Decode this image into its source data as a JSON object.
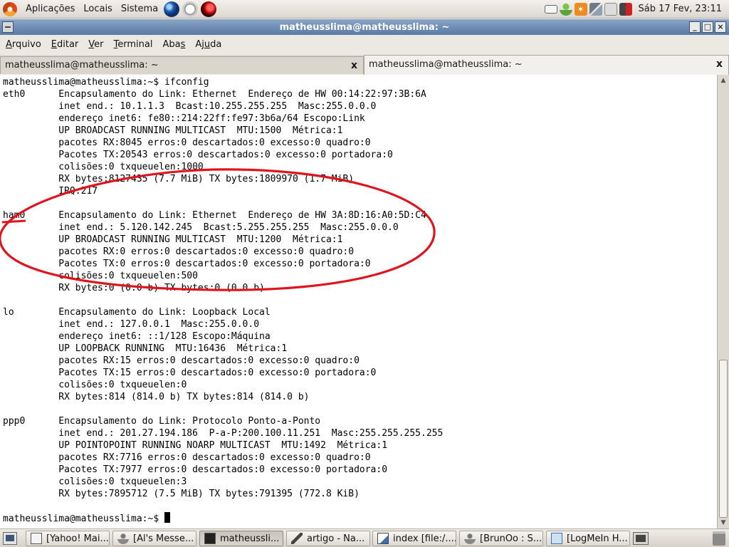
{
  "top_panel": {
    "menus": [
      "Aplicações",
      "Locais",
      "Sistema"
    ],
    "launchers": [
      "globe-icon",
      "clock-icon",
      "bug-icon"
    ],
    "tray_icons": [
      "mail-icon",
      "user-icon",
      "update-icon",
      "network-icon",
      "volume-icon",
      "quit-icon"
    ],
    "clock": "Sáb 17 Fev, 23:11"
  },
  "window": {
    "title": "matheusslima@matheusslima: ~",
    "menu": [
      {
        "pre": "",
        "key": "A",
        "post": "rquivo"
      },
      {
        "pre": "",
        "key": "E",
        "post": "ditar"
      },
      {
        "pre": "",
        "key": "V",
        "post": "er"
      },
      {
        "pre": "",
        "key": "T",
        "post": "erminal"
      },
      {
        "pre": "Aba",
        "key": "s",
        "post": ""
      },
      {
        "pre": "Aj",
        "key": "u",
        "post": "da"
      }
    ],
    "tabs": [
      {
        "label": "matheusslima@matheusslima: ~",
        "close": "x"
      },
      {
        "label": "matheusslima@matheusslima: ~",
        "close": "x"
      }
    ]
  },
  "terminal": {
    "lines": [
      "matheusslima@matheusslima:~$ ifconfig",
      "eth0      Encapsulamento do Link: Ethernet  Endereço de HW 00:14:22:97:3B:6A",
      "          inet end.: 10.1.1.3  Bcast:10.255.255.255  Masc:255.0.0.0",
      "          endereço inet6: fe80::214:22ff:fe97:3b6a/64 Escopo:Link",
      "          UP BROADCAST RUNNING MULTICAST  MTU:1500  Métrica:1",
      "          pacotes RX:8045 erros:0 descartados:0 excesso:0 quadro:0",
      "          Pacotes TX:20543 erros:0 descartados:0 excesso:0 portadora:0",
      "          colisões:0 txqueuelen:1000",
      "          RX bytes:8127435 (7.7 MiB) TX bytes:1809970 (1.7 MiB)",
      "          IRQ:217",
      "",
      "ham0      Encapsulamento do Link: Ethernet  Endereço de HW 3A:8D:16:A0:5D:C4",
      "          inet end.: 5.120.142.245  Bcast:5.255.255.255  Masc:255.0.0.0",
      "          UP BROADCAST RUNNING MULTICAST  MTU:1200  Métrica:1",
      "          pacotes RX:0 erros:0 descartados:0 excesso:0 quadro:0",
      "          Pacotes TX:0 erros:0 descartados:0 excesso:0 portadora:0",
      "          colisões:0 txqueuelen:500",
      "          RX bytes:0 (0.0 b) TX bytes:0 (0.0 b)",
      "",
      "lo        Encapsulamento do Link: Loopback Local",
      "          inet end.: 127.0.0.1  Masc:255.0.0.0",
      "          endereço inet6: ::1/128 Escopo:Máquina",
      "          UP LOOPBACK RUNNING  MTU:16436  Métrica:1",
      "          pacotes RX:15 erros:0 descartados:0 excesso:0 quadro:0",
      "          Pacotes TX:15 erros:0 descartados:0 excesso:0 portadora:0",
      "          colisões:0 txqueuelen:0",
      "          RX bytes:814 (814.0 b) TX bytes:814 (814.0 b)",
      "",
      "ppp0      Encapsulamento do Link: Protocolo Ponto-a-Ponto",
      "          inet end.: 201.27.194.186  P-a-P:200.100.11.251  Masc:255.255.255.255",
      "          UP POINTOPOINT RUNNING NOARP MULTICAST  MTU:1492  Métrica:1",
      "          pacotes RX:7716 erros:0 descartados:0 excesso:0 quadro:0",
      "          Pacotes TX:7977 erros:0 descartados:0 excesso:0 portadora:0",
      "          colisões:0 txqueuelen:3",
      "          RX bytes:7895712 (7.5 MiB) TX bytes:791395 (772.8 KiB)",
      ""
    ],
    "prompt": "matheusslima@matheusslima:~$ ",
    "annotation_color": "#e0141c"
  },
  "taskbar": {
    "tasks": [
      {
        "label": "[Yahoo! Mai...",
        "icon": "window-icon"
      },
      {
        "label": "[Al's Messe...",
        "icon": "pidgin-icon"
      },
      {
        "label": "matheussli...",
        "icon": "terminal-icon",
        "active": true
      },
      {
        "label": "artigo - Na...",
        "icon": "pen-icon"
      },
      {
        "label": "index [file:/....",
        "icon": "page-icon"
      },
      {
        "label": "[BrunOo : S...",
        "icon": "pidgin-icon"
      },
      {
        "label": "[LogMeIn H...",
        "icon": "logmein-icon"
      }
    ]
  }
}
